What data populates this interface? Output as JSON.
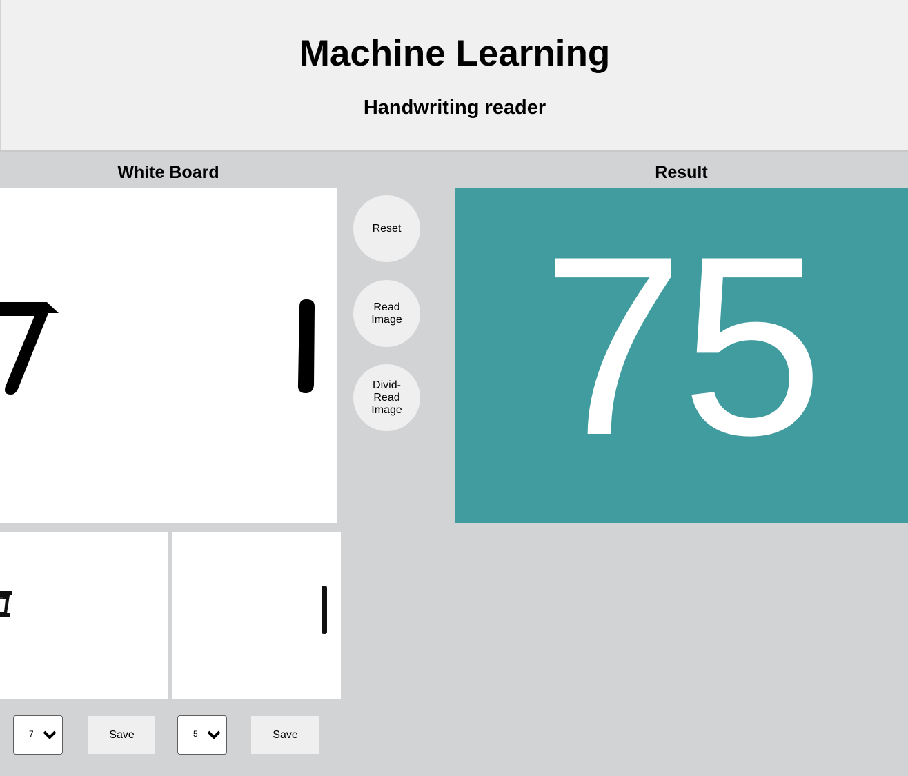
{
  "header": {
    "title": "Machine Learning",
    "subtitle": "Handwriting reader"
  },
  "board": {
    "title": "White Board"
  },
  "result": {
    "title": "Result",
    "value": "75",
    "background_color": "#409c9e"
  },
  "actions": {
    "reset_label": "Reset",
    "read_label_line1": "Read",
    "read_label_line2": "Image",
    "divid_label_line1": "Divid-",
    "divid_label_line2": "Read",
    "divid_label_line3": "Image"
  },
  "controls": [
    {
      "select_value": "7",
      "save_label": "Save"
    },
    {
      "select_value": "5",
      "save_label": "Save"
    }
  ],
  "icons": {
    "select_chevron": "chevron-down-icon"
  }
}
